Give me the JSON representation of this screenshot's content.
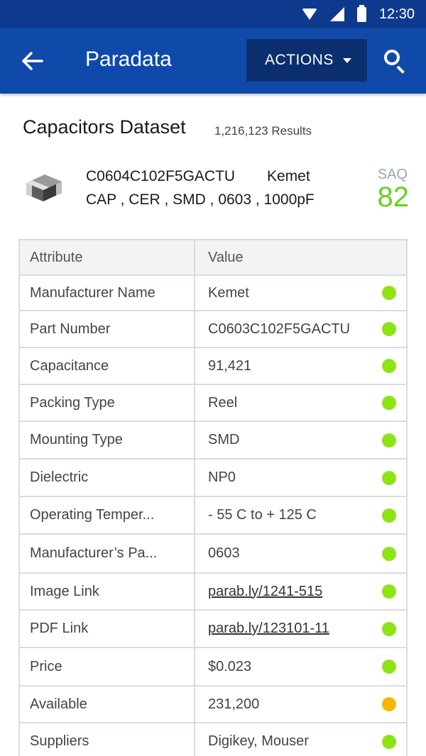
{
  "status_bar": {
    "time": "12:30",
    "icons": [
      "wifi-icon",
      "signal-icon",
      "battery-icon"
    ]
  },
  "app_bar": {
    "back_icon": "arrow-left-icon",
    "title": "Paradata",
    "actions_label": "ACTIONS",
    "search_icon": "search-icon"
  },
  "dataset": {
    "title": "Capacitors Dataset",
    "results": "1,216,123 Results"
  },
  "part": {
    "number": "C0604C102F5GACTU",
    "manufacturer": "Kemet",
    "description": "CAP , CER , SMD , 0603 , 1000pF",
    "saq_label": "SAQ",
    "saq_score": "82",
    "image_icon": "capacitor-chip-icon"
  },
  "colors": {
    "status_bar": "#0d3a8c",
    "app_bar": "#0f4aab",
    "actions_button": "#0b2f6e",
    "good": "#8ee314",
    "warning": "#f5b800",
    "saq_score": "#64d21e"
  },
  "table": {
    "headers": {
      "attribute": "Attribute",
      "value": "Value"
    },
    "rows": [
      {
        "attribute": "Manufacturer Name",
        "value": "Kemet",
        "status": "good",
        "link": false
      },
      {
        "attribute": "Part Number",
        "value": "C0603C102F5GACTU",
        "status": "good",
        "link": false
      },
      {
        "attribute": "Capacitance",
        "value": "91,421",
        "status": "good",
        "link": false
      },
      {
        "attribute": "Packing Type",
        "value": "Reel",
        "status": "good",
        "link": false
      },
      {
        "attribute": "Mounting Type",
        "value": "SMD",
        "status": "good",
        "link": false
      },
      {
        "attribute": "Dielectric",
        "value": "NP0",
        "status": "good",
        "link": false
      },
      {
        "attribute": "Operating Temper...",
        "value": "- 55 C to + 125 C",
        "status": "good",
        "link": false
      },
      {
        "attribute": "Manufacturer’s Pa...",
        "value": "0603",
        "status": "good",
        "link": false
      },
      {
        "attribute": "Image Link",
        "value": "parab.ly/1241-515",
        "status": "good",
        "link": true
      },
      {
        "attribute": "PDF Link",
        "value": "parab.ly/123101-11",
        "status": "good",
        "link": true
      },
      {
        "attribute": "Price",
        "value": "$0.023",
        "status": "good",
        "link": false
      },
      {
        "attribute": "Available",
        "value": "231,200",
        "status": "warning",
        "link": false
      },
      {
        "attribute": "Suppliers",
        "value": "Digikey, Mouser",
        "status": "good",
        "link": false
      }
    ]
  }
}
